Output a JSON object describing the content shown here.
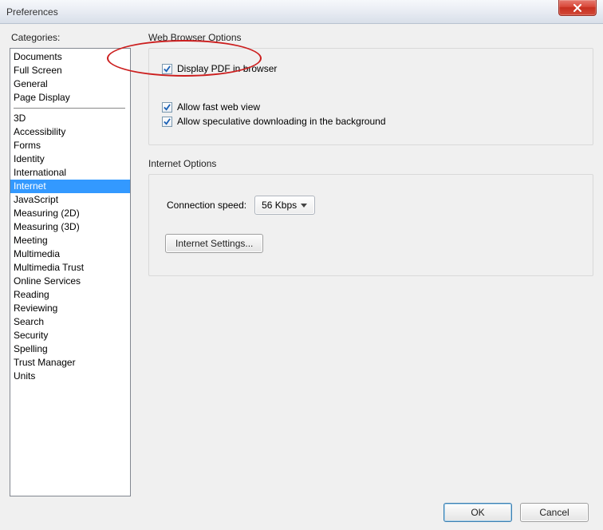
{
  "window": {
    "title": "Preferences"
  },
  "sidebar": {
    "label": "Categories:",
    "groups": [
      [
        "Documents",
        "Full Screen",
        "General",
        "Page Display"
      ],
      [
        "3D",
        "Accessibility",
        "Forms",
        "Identity",
        "International",
        "Internet",
        "JavaScript",
        "Measuring (2D)",
        "Measuring (3D)",
        "Meeting",
        "Multimedia",
        "Multimedia Trust",
        "Online Services",
        "Reading",
        "Reviewing",
        "Search",
        "Security",
        "Spelling",
        "Trust Manager",
        "Units"
      ]
    ],
    "selected": "Internet"
  },
  "panel": {
    "webBrowser": {
      "title": "Web Browser Options",
      "displayPdf": {
        "label": "Display PDF in browser",
        "checked": true
      },
      "fastWeb": {
        "label": "Allow fast web view",
        "checked": true
      },
      "speculative": {
        "label": "Allow speculative downloading in the background",
        "checked": true
      }
    },
    "internet": {
      "title": "Internet Options",
      "connLabel": "Connection speed:",
      "connValue": "56 Kbps",
      "settingsBtn": "Internet Settings..."
    }
  },
  "buttons": {
    "ok": "OK",
    "cancel": "Cancel"
  }
}
